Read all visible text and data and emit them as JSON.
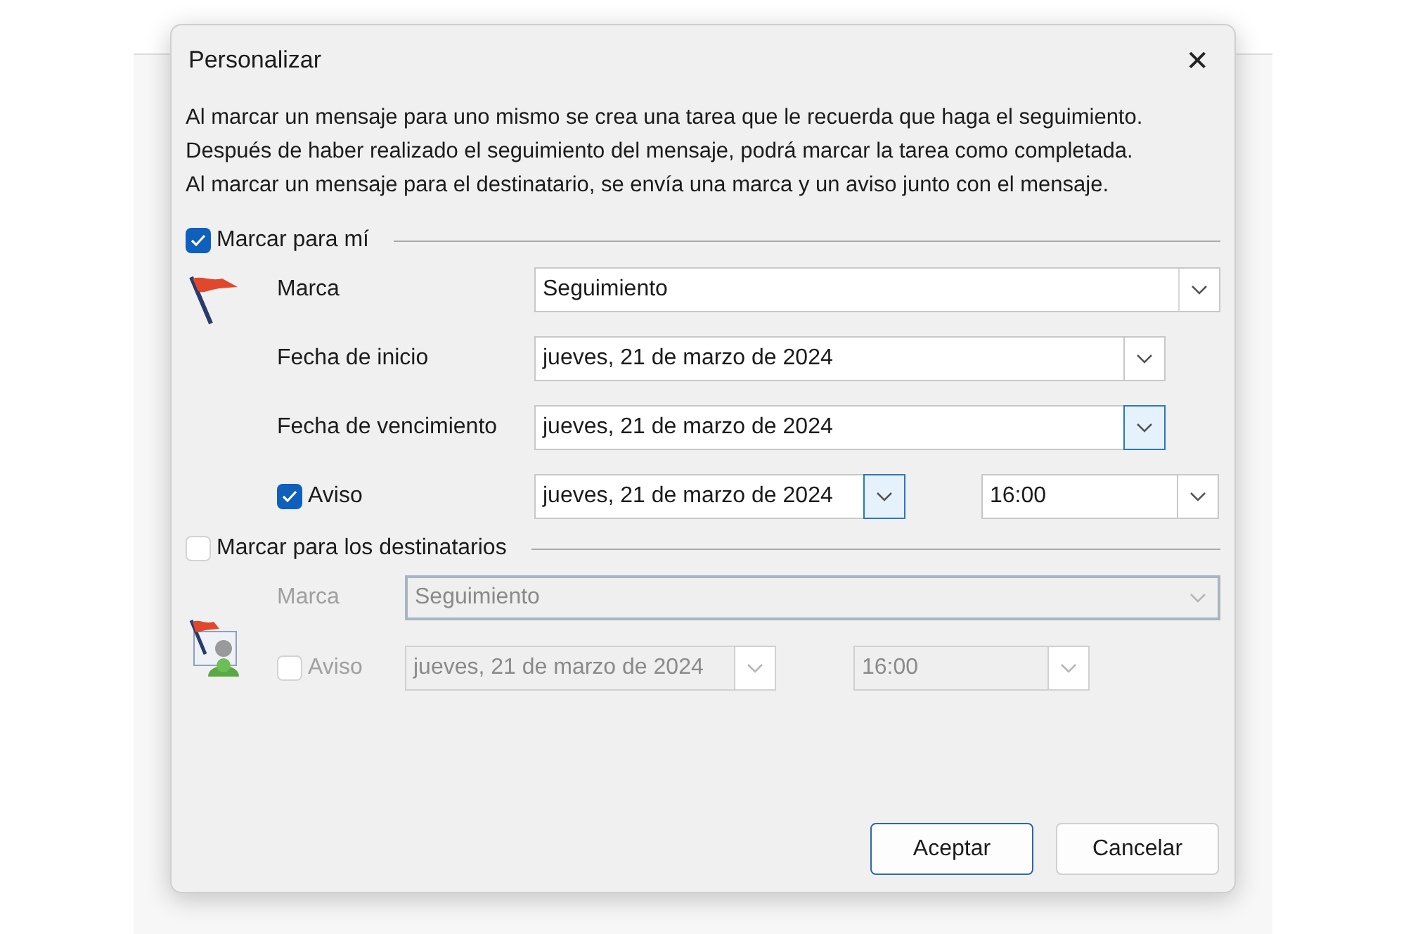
{
  "dialog": {
    "title": "Personalizar",
    "close": "✕"
  },
  "description": "Al marcar un mensaje para uno mismo se crea una tarea que le recuerda que haga el seguimiento. Después de haber realizado el seguimiento del mensaje, podrá marcar la tarea como completada. Al marcar un mensaje para el destinatario, se envía una marca y un aviso junto con el mensaje.",
  "sections": [
    {
      "kind": "self",
      "label": "Marcar para mí",
      "checked": true,
      "disabled": false,
      "fields": [
        {
          "kind": "combo",
          "label": "Marca",
          "value": "Seguimiento",
          "highlighted": false
        },
        {
          "kind": "date",
          "label": "Fecha de inicio",
          "value": "jueves, 21 de marzo de 2024",
          "highlighted": false
        },
        {
          "kind": "date",
          "label": "Fecha de vencimiento",
          "value": "jueves, 21 de marzo de 2024",
          "highlighted": true
        },
        {
          "kind": "reminder",
          "label": "Aviso",
          "checked": true,
          "value": "jueves, 21 de marzo de 2024",
          "highlighted": true,
          "time": "16:00"
        }
      ]
    },
    {
      "kind": "recipients",
      "label": "Marcar para los destinatarios",
      "checked": false,
      "disabled": true,
      "fields": [
        {
          "kind": "combo",
          "label": "Marca",
          "value": "Seguimiento",
          "highlighted": false
        },
        {
          "kind": "reminder",
          "label": "Aviso",
          "checked": false,
          "value": "jueves, 21 de marzo de 2024",
          "highlighted": false,
          "time": "16:00"
        }
      ]
    }
  ],
  "buttons": [
    {
      "label": "Aceptar",
      "default": true
    },
    {
      "label": "Cancelar",
      "default": false
    }
  ]
}
